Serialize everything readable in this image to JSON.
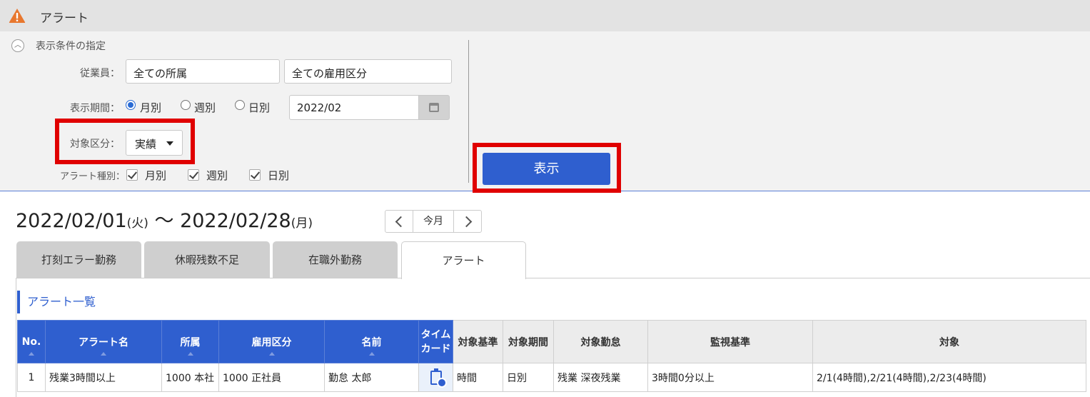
{
  "window": {
    "title": "アラート"
  },
  "filter": {
    "section_label": "表示条件の指定",
    "employee_label": "従業員：",
    "affiliation_value": "全ての所属",
    "employment_value": "全ての雇用区分",
    "period_label": "表示期間：",
    "period_options": [
      "月別",
      "週別",
      "日別"
    ],
    "period_selected": "月別",
    "period_value": "2022/02",
    "target_label": "対象区分：",
    "target_value": "実績",
    "alert_type_label": "アラート種別：",
    "alert_types": [
      "月別",
      "週別",
      "日別"
    ],
    "show_button": "表示"
  },
  "range": {
    "start": "2022/02/01",
    "start_wd": "(火)",
    "sep": "〜",
    "end": "2022/02/28",
    "end_wd": "(月)",
    "today_button": "今月"
  },
  "tabs": [
    "打刻エラー勤務",
    "休暇残数不足",
    "在職外勤務",
    "アラート"
  ],
  "active_tab": "アラート",
  "list": {
    "title": "アラート一覧",
    "columns": [
      "No.",
      "アラート名",
      "所属",
      "雇用区分",
      "名前",
      "タイム\nカード",
      "対象基準",
      "対象期間",
      "対象勤怠",
      "監視基準",
      "対象"
    ],
    "rows": [
      [
        "1",
        "残業3時間以上",
        "1000 本社",
        "1000 正社員",
        "勤怠 太郎",
        "",
        "時間",
        "日別",
        "残業 深夜残業",
        "3時間0分以上",
        "2/1(4時間),2/21(4時間),2/23(4時間)"
      ]
    ]
  },
  "colors": {
    "accent": "#2f5fcf",
    "highlight": "#e00000",
    "warning": "#e8772e"
  }
}
